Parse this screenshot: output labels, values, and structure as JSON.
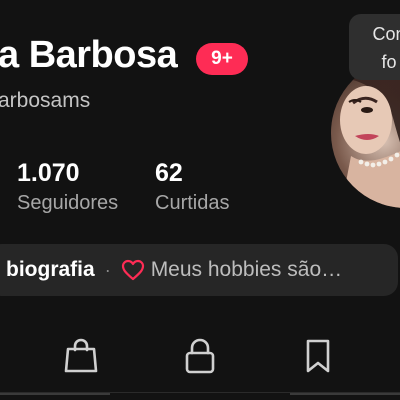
{
  "profile": {
    "name": "a Barbosa",
    "username": "arbosams",
    "notification_badge": "9+",
    "avatar_icon": "profile-photo"
  },
  "edit_tooltip": {
    "line1": "Con",
    "line2": "fo"
  },
  "stats": {
    "followers": {
      "value": "1.070",
      "label": "Seguidores"
    },
    "likes": {
      "value": "62",
      "label": "Curtidas"
    }
  },
  "bio": {
    "add_label": "biografia",
    "separator": "·",
    "icon": "heart-outline-icon",
    "text": "Meus hobbies são…"
  },
  "tabs": [
    {
      "name": "shop",
      "icon": "shopping-bag-icon"
    },
    {
      "name": "private",
      "icon": "lock-icon"
    },
    {
      "name": "saved",
      "icon": "bookmark-icon"
    }
  ],
  "colors": {
    "background": "#121212",
    "badge": "#fe2c55",
    "heart": "#fe2c55",
    "bio_bar": "#262626"
  }
}
